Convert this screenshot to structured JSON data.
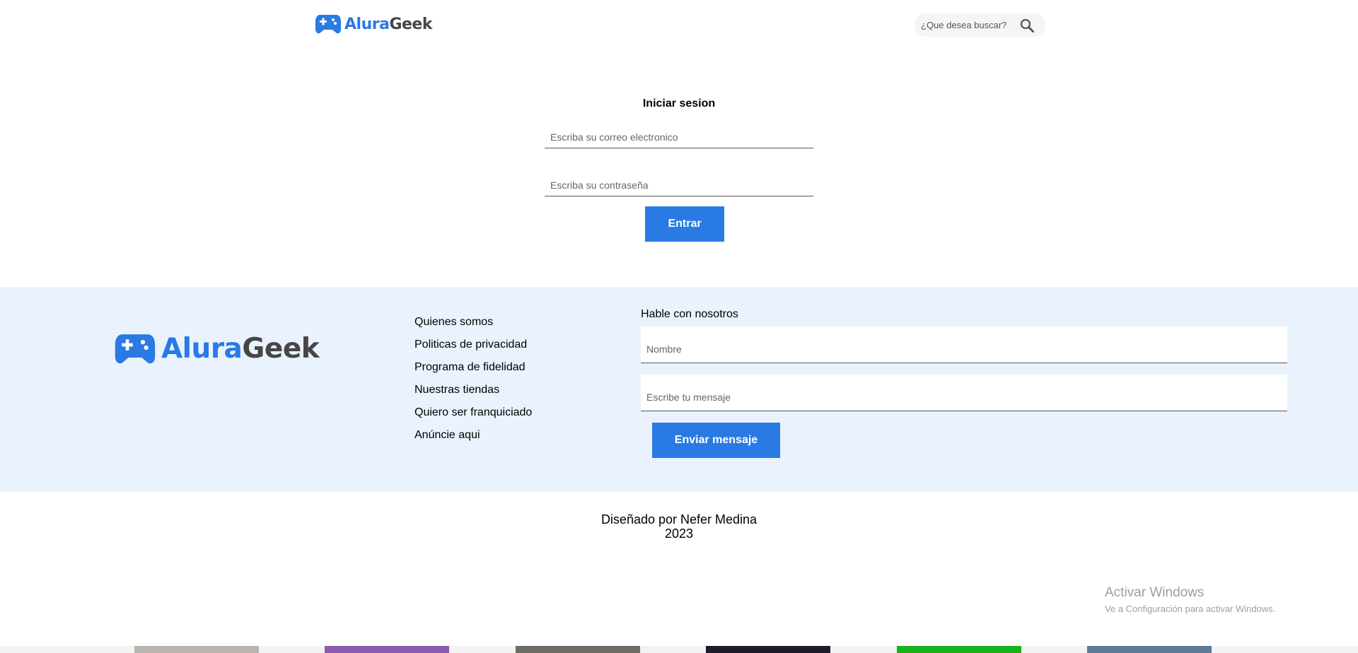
{
  "header": {
    "logo": {
      "part1": "Alura",
      "part2": "Geek"
    },
    "search": {
      "placeholder": "¿Que desea buscar?"
    }
  },
  "login": {
    "title": "Iniciar sesion",
    "email_placeholder": "Escriba su correo electronico",
    "password_placeholder": "Escriba su contraseña",
    "submit_label": "Entrar"
  },
  "footer": {
    "logo": {
      "part1": "Alura",
      "part2": "Geek"
    },
    "links": [
      "Quienes somos",
      "Politicas de privacidad",
      "Programa de fidelidad",
      "Nuestras tiendas",
      "Quiero ser franquiciado",
      "Anúncie aqui"
    ],
    "contact": {
      "title": "Hable con nosotros",
      "name_placeholder": "Nombre",
      "message_placeholder": "Escribe tu mensaje",
      "submit_label": "Enviar mensaje"
    }
  },
  "credits": {
    "line1": "Diseñado por Nefer Medina",
    "line2": "2023"
  },
  "watermark": {
    "title": "Activar Windows",
    "subtitle": "Ve a Configuración para activar Windows."
  },
  "thumbnails": [
    {
      "name": "product-thumb-1",
      "color": "#b9b4ad"
    },
    {
      "name": "product-thumb-2",
      "color": "#8a5bb0"
    },
    {
      "name": "product-thumb-3",
      "color": "#6d6b63"
    },
    {
      "name": "product-thumb-4",
      "color": "#1c1c2a"
    },
    {
      "name": "product-thumb-5",
      "color": "#19b319"
    },
    {
      "name": "product-thumb-6",
      "color": "#5e7a94"
    }
  ],
  "colors": {
    "accent": "#2a7ae4",
    "footer_bg": "#eaf2fd",
    "logo_dark": "#464646"
  },
  "icons": {
    "logo": "gamepad-icon",
    "search": "search-icon"
  }
}
